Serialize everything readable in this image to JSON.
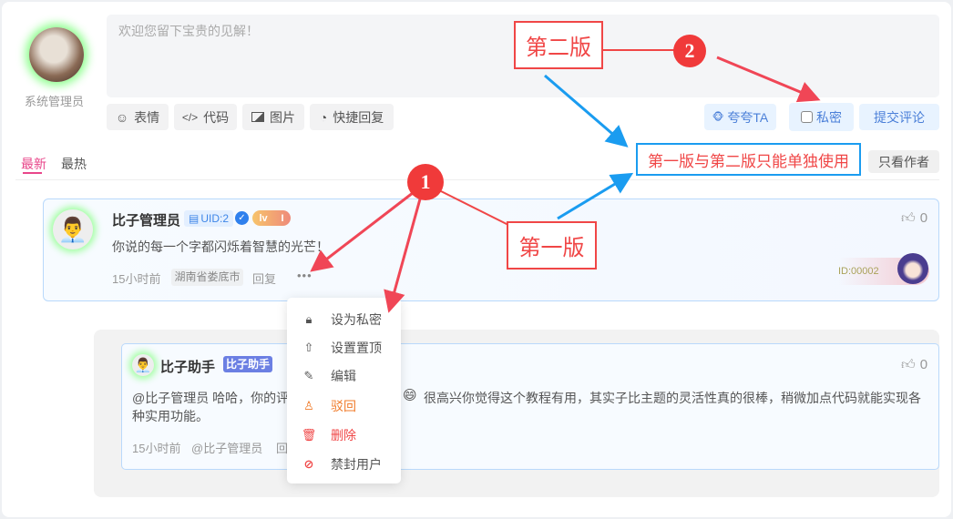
{
  "editor": {
    "user_name": "系统管理员",
    "placeholder": "欢迎您留下宝贵的见解！",
    "tools": [
      {
        "icon": "smile-icon",
        "label": "表情"
      },
      {
        "icon": "code-icon",
        "label": "代码"
      },
      {
        "icon": "image-icon",
        "label": "图片"
      },
      {
        "icon": "quick-reply-icon",
        "label": "快捷回复"
      }
    ],
    "praise_label": "夸夸TA",
    "private_label": "私密",
    "submit_label": "提交评论"
  },
  "tabs": [
    {
      "label": "最新",
      "active": true
    },
    {
      "label": "最热"
    }
  ],
  "author_only_label": "只看作者",
  "comment": {
    "name": "比子管理员",
    "uid": "UID:2",
    "level": "lv",
    "level_num": "I",
    "text": "你说的每一个字都闪烁着智慧的光芒！",
    "time": "15小时前",
    "location": "湖南省娄底市",
    "reply_label": "回复",
    "likes": "0",
    "id_badge": "ID:00002"
  },
  "reply": {
    "name": "比子助手",
    "badge": "比子助手",
    "text_a": "@比子管理员 哈哈，你的评",
    "emoji": "😄",
    "text_b": "很高兴你觉得这个教程有用，其实子比主题的灵活性真的很棒，稍微加点代码就能实现各",
    "text_c": "种实用功能。",
    "time": "15小时前",
    "mention": "@比子管理员",
    "reply_label": "回",
    "likes": "0"
  },
  "menu": [
    {
      "icon": "lock-icon",
      "label": "设为私密",
      "color": "#555"
    },
    {
      "icon": "pin-top-icon",
      "label": "设置置顶",
      "color": "#555"
    },
    {
      "icon": "edit-icon",
      "label": "编辑",
      "color": "#555"
    },
    {
      "icon": "reject-icon",
      "label": "驳回",
      "color": "#f07b2a"
    },
    {
      "icon": "trash-icon",
      "label": "删除",
      "color": "#f04646"
    },
    {
      "icon": "ban-icon",
      "label": "禁封用户",
      "color": "#555"
    }
  ],
  "annotations": {
    "v2": "第二版",
    "v1": "第一版",
    "n1": "1",
    "n2": "2",
    "note": "第一版与第二版只能单独使用"
  }
}
